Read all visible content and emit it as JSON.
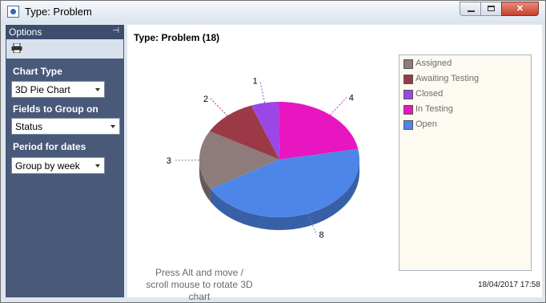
{
  "window": {
    "title": "Type: Problem",
    "controls": {
      "minimize": "minimize-icon",
      "maximize": "maximize-icon",
      "close": "✕"
    }
  },
  "options": {
    "header": "Options",
    "chart_type_label": "Chart Type",
    "chart_type_value": "3D Pie Chart",
    "fields_label": "Fields to Group on",
    "fields_value": "Status",
    "period_label": "Period for dates",
    "period_value": "Group by week"
  },
  "main": {
    "title": "Type: Problem  (18)",
    "hint": "Press Alt and move / scroll mouse to rotate 3D chart",
    "timestamp": "18/04/2017 17:58"
  },
  "chart_data": {
    "type": "pie",
    "categories": [
      "Assigned",
      "Awaiting Testing",
      "Closed",
      "In Testing",
      "Open"
    ],
    "values": [
      3,
      2,
      1,
      4,
      8
    ],
    "data_labels": [
      "3",
      "2",
      "1",
      "4",
      "8"
    ],
    "colors": [
      "#8e7b7b",
      "#9b3a46",
      "#9b47e8",
      "#e816c0",
      "#4d86e8"
    ],
    "legend_position": "right"
  }
}
